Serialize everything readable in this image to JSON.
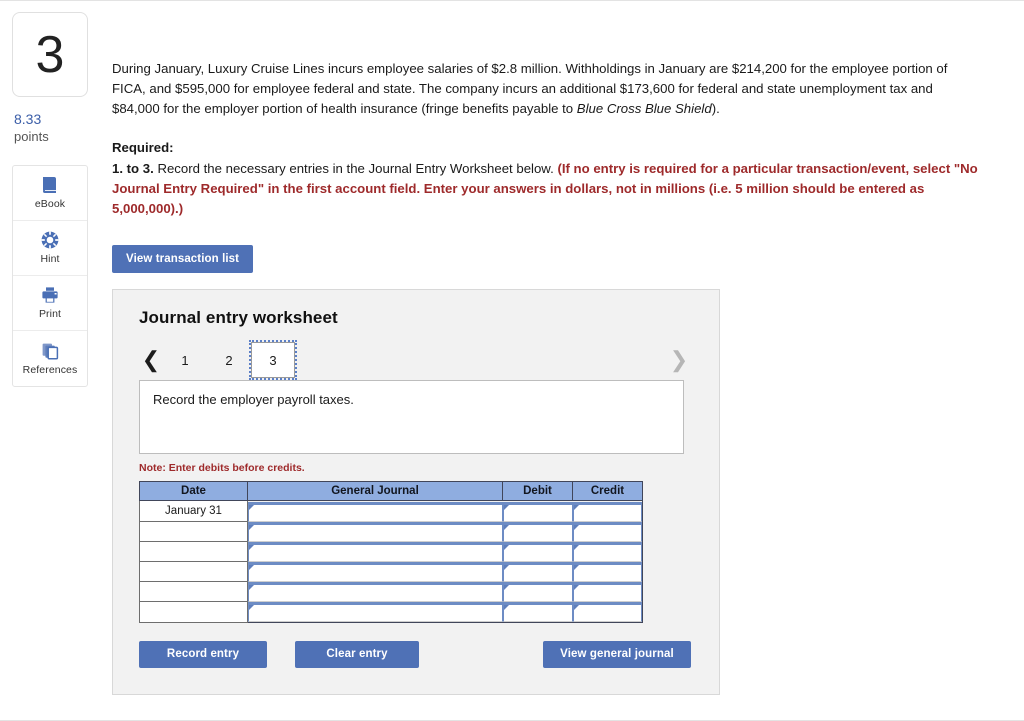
{
  "question": {
    "number": "3",
    "points_value": "8.33",
    "points_label": "points"
  },
  "tools": [
    {
      "label": "eBook",
      "icon": "book-icon"
    },
    {
      "label": "Hint",
      "icon": "lifebuoy-icon"
    },
    {
      "label": "Print",
      "icon": "printer-icon"
    },
    {
      "label": "References",
      "icon": "copy-pages-icon"
    }
  ],
  "stem": {
    "part1": "During January, Luxury Cruise Lines incurs employee salaries of $2.8 million. Withholdings in January are $214,200 for the employee portion of FICA, and $595,000 for employee federal and state. The company incurs an additional $173,600 for federal and state unemployment tax and $84,000 for the employer portion of health insurance (fringe benefits payable to ",
    "italic": "Blue Cross Blue Shield",
    "part2": ")."
  },
  "required": {
    "title": "Required:",
    "prefix": "1. to 3.",
    "black": " Record the necessary entries in the Journal Entry Worksheet below. ",
    "red": "(If no entry is required for a particular transaction/event, select \"No Journal Entry Required\" in the first account field. Enter your answers in dollars, not in millions (i.e. 5 million should be entered as 5,000,000).)"
  },
  "buttons": {
    "view_transaction_list": "View transaction list",
    "record_entry": "Record entry",
    "clear_entry": "Clear entry",
    "view_general_journal": "View general journal"
  },
  "worksheet": {
    "title": "Journal entry worksheet",
    "pager": {
      "prev_icon": "chevron-left-icon",
      "next_icon": "chevron-right-icon",
      "pages": [
        "1",
        "2",
        "3"
      ],
      "active_page": "3"
    },
    "description": "Record the employer payroll taxes.",
    "note": "Note: Enter debits before credits.",
    "table": {
      "headers": [
        "Date",
        "General Journal",
        "Debit",
        "Credit"
      ],
      "rows": [
        {
          "date": "January 31",
          "general_journal": "",
          "debit": "",
          "credit": ""
        },
        {
          "date": "",
          "general_journal": "",
          "debit": "",
          "credit": ""
        },
        {
          "date": "",
          "general_journal": "",
          "debit": "",
          "credit": ""
        },
        {
          "date": "",
          "general_journal": "",
          "debit": "",
          "credit": ""
        },
        {
          "date": "",
          "general_journal": "",
          "debit": "",
          "credit": ""
        },
        {
          "date": "",
          "general_journal": "",
          "debit": "",
          "credit": ""
        }
      ]
    }
  },
  "colors": {
    "button_blue": "#4f71b6",
    "table_header_blue": "#8fade0",
    "field_border_blue": "#6d8cc4",
    "red_text": "#9e2a2b",
    "points_blue": "#3b5ea8",
    "panel_gray": "#f2f2f2"
  }
}
